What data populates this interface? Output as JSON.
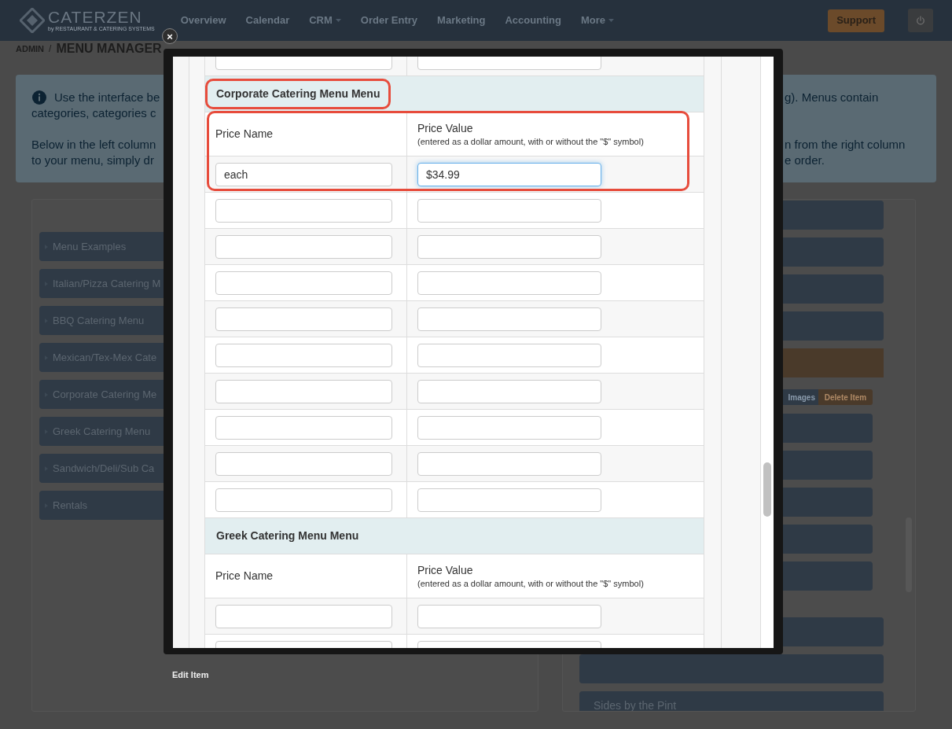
{
  "header": {
    "logo": {
      "name": "CATERZEN",
      "tagline": "by RESTAURANT & CATERING SYSTEMS"
    },
    "nav": [
      {
        "label": "Overview",
        "dropdown": false
      },
      {
        "label": "Calendar",
        "dropdown": false
      },
      {
        "label": "CRM",
        "dropdown": true
      },
      {
        "label": "Order Entry",
        "dropdown": false
      },
      {
        "label": "Marketing",
        "dropdown": false
      },
      {
        "label": "Accounting",
        "dropdown": false
      },
      {
        "label": "More",
        "dropdown": true
      }
    ],
    "support": "Support"
  },
  "breadcrumb": {
    "section": "ADMIN",
    "separator": "/",
    "page": "MENU MANAGER"
  },
  "info": {
    "paragraphs": [
      [
        {
          "left": "Use the interface be",
          "right": "g). Menus contain"
        },
        {
          "left": "categories, categories c"
        }
      ],
      [
        {
          "left": "Below in the left column",
          "right": "n from the right column"
        },
        {
          "left": "to your menu, simply dr",
          "right": "e order."
        }
      ]
    ]
  },
  "menus": [
    "Menu Examples",
    "Italian/Pizza Catering M",
    "BBQ Catering Menu",
    "Mexican/Tex-Mex Cate",
    "Corporate Catering Me",
    "Greek Catering Menu",
    "Sandwich/Deli/Sub Ca",
    "Rentals"
  ],
  "items": [
    {
      "kind": "cut"
    },
    {
      "kind": "item"
    },
    {
      "kind": "item"
    },
    {
      "kind": "item"
    },
    {
      "kind": "accent"
    },
    {
      "kind": "actions",
      "buttons": [
        {
          "label": "Images",
          "kind": "plain"
        },
        {
          "label": "Delete Item",
          "kind": "danger"
        }
      ]
    },
    {
      "kind": "subitem"
    },
    {
      "kind": "subitem"
    },
    {
      "kind": "subitem"
    },
    {
      "kind": "subitem"
    },
    {
      "kind": "subitem"
    },
    {
      "kind": "item"
    },
    {
      "kind": "item"
    },
    {
      "kind": "item",
      "label": "Sides by the Pint"
    }
  ],
  "modal": {
    "close": "×",
    "caption": "Edit Item",
    "sections": [
      {
        "rows": [
          {
            "cells": [
              {
                "focused": false
              },
              {
                "focused": false
              }
            ]
          }
        ]
      },
      {
        "title": "Corporate Catering Menu Menu",
        "title_highlighted": true,
        "table_highlighted": true,
        "columns": [
          {
            "label": "Price Name"
          },
          {
            "label": "Price Value",
            "hint": "(entered as a dollar amount, with or without the \"$\" symbol)"
          }
        ],
        "rows": [
          {
            "cells": [
              {
                "value": "each",
                "focused": false
              },
              {
                "value": "$34.99",
                "focused": true
              }
            ]
          },
          {
            "cells": [
              {
                "focused": false
              },
              {
                "focused": false
              }
            ]
          },
          {
            "cells": [
              {
                "focused": false
              },
              {
                "focused": false
              }
            ]
          },
          {
            "cells": [
              {
                "focused": false
              },
              {
                "focused": false
              }
            ]
          },
          {
            "cells": [
              {
                "focused": false
              },
              {
                "focused": false
              }
            ]
          },
          {
            "cells": [
              {
                "focused": false
              },
              {
                "focused": false
              }
            ]
          },
          {
            "cells": [
              {
                "focused": false
              },
              {
                "focused": false
              }
            ]
          },
          {
            "cells": [
              {
                "focused": false
              },
              {
                "focused": false
              }
            ]
          },
          {
            "cells": [
              {
                "focused": false
              },
              {
                "focused": false
              }
            ]
          },
          {
            "cells": [
              {
                "focused": false
              },
              {
                "focused": false
              }
            ]
          }
        ]
      },
      {
        "title": "Greek Catering Menu Menu",
        "title_highlighted": false,
        "table_highlighted": false,
        "columns": [
          {
            "label": "Price Name"
          },
          {
            "label": "Price Value",
            "hint": "(entered as a dollar amount, with or without the \"$\" symbol)"
          }
        ],
        "rows": [
          {
            "cells": [
              {
                "focused": false
              },
              {
                "focused": false
              }
            ]
          },
          {
            "cells": [
              {
                "focused": false
              },
              {
                "focused": false
              }
            ]
          }
        ]
      }
    ]
  }
}
